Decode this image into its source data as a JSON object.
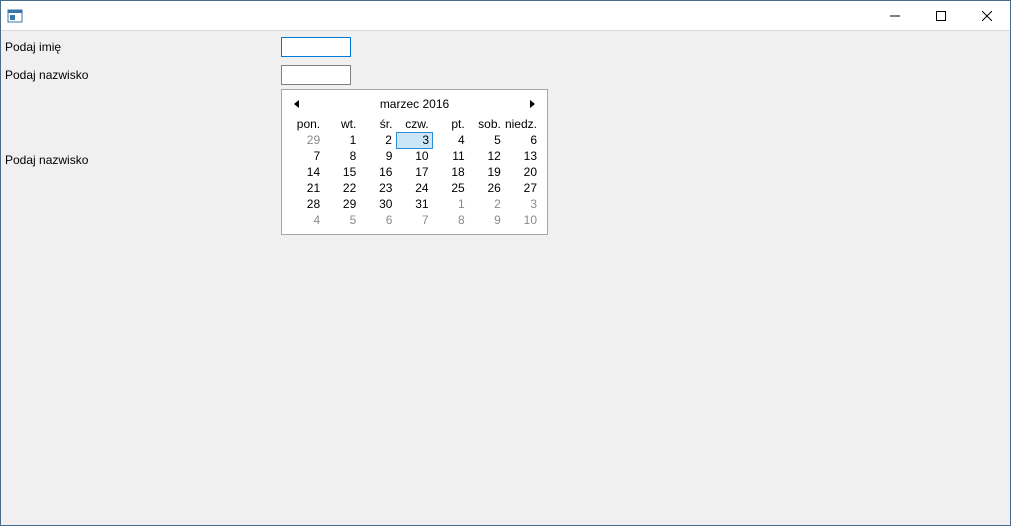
{
  "window": {
    "title": ""
  },
  "labels": {
    "first_name": "Podaj imię",
    "last_name": "Podaj nazwisko",
    "last_name2": "Podaj nazwisko"
  },
  "inputs": {
    "first_name_value": "",
    "last_name_value": ""
  },
  "calendar": {
    "title": "marzec 2016",
    "day_headers": [
      "pon.",
      "wt.",
      "śr.",
      "czw.",
      "pt.",
      "sob.",
      "niedz."
    ],
    "weeks": [
      [
        {
          "d": 29,
          "other": true
        },
        {
          "d": 1
        },
        {
          "d": 2
        },
        {
          "d": 3,
          "selected": true
        },
        {
          "d": 4
        },
        {
          "d": 5
        },
        {
          "d": 6
        }
      ],
      [
        {
          "d": 7
        },
        {
          "d": 8
        },
        {
          "d": 9
        },
        {
          "d": 10
        },
        {
          "d": 11
        },
        {
          "d": 12
        },
        {
          "d": 13
        }
      ],
      [
        {
          "d": 14
        },
        {
          "d": 15
        },
        {
          "d": 16
        },
        {
          "d": 17
        },
        {
          "d": 18
        },
        {
          "d": 19
        },
        {
          "d": 20
        }
      ],
      [
        {
          "d": 21
        },
        {
          "d": 22
        },
        {
          "d": 23
        },
        {
          "d": 24
        },
        {
          "d": 25
        },
        {
          "d": 26
        },
        {
          "d": 27
        }
      ],
      [
        {
          "d": 28
        },
        {
          "d": 29
        },
        {
          "d": 30
        },
        {
          "d": 31
        },
        {
          "d": 1,
          "other": true
        },
        {
          "d": 2,
          "other": true
        },
        {
          "d": 3,
          "other": true
        }
      ],
      [
        {
          "d": 4,
          "other": true
        },
        {
          "d": 5,
          "other": true
        },
        {
          "d": 6,
          "other": true
        },
        {
          "d": 7,
          "other": true
        },
        {
          "d": 8,
          "other": true
        },
        {
          "d": 9,
          "other": true
        },
        {
          "d": 10,
          "other": true
        }
      ]
    ]
  }
}
